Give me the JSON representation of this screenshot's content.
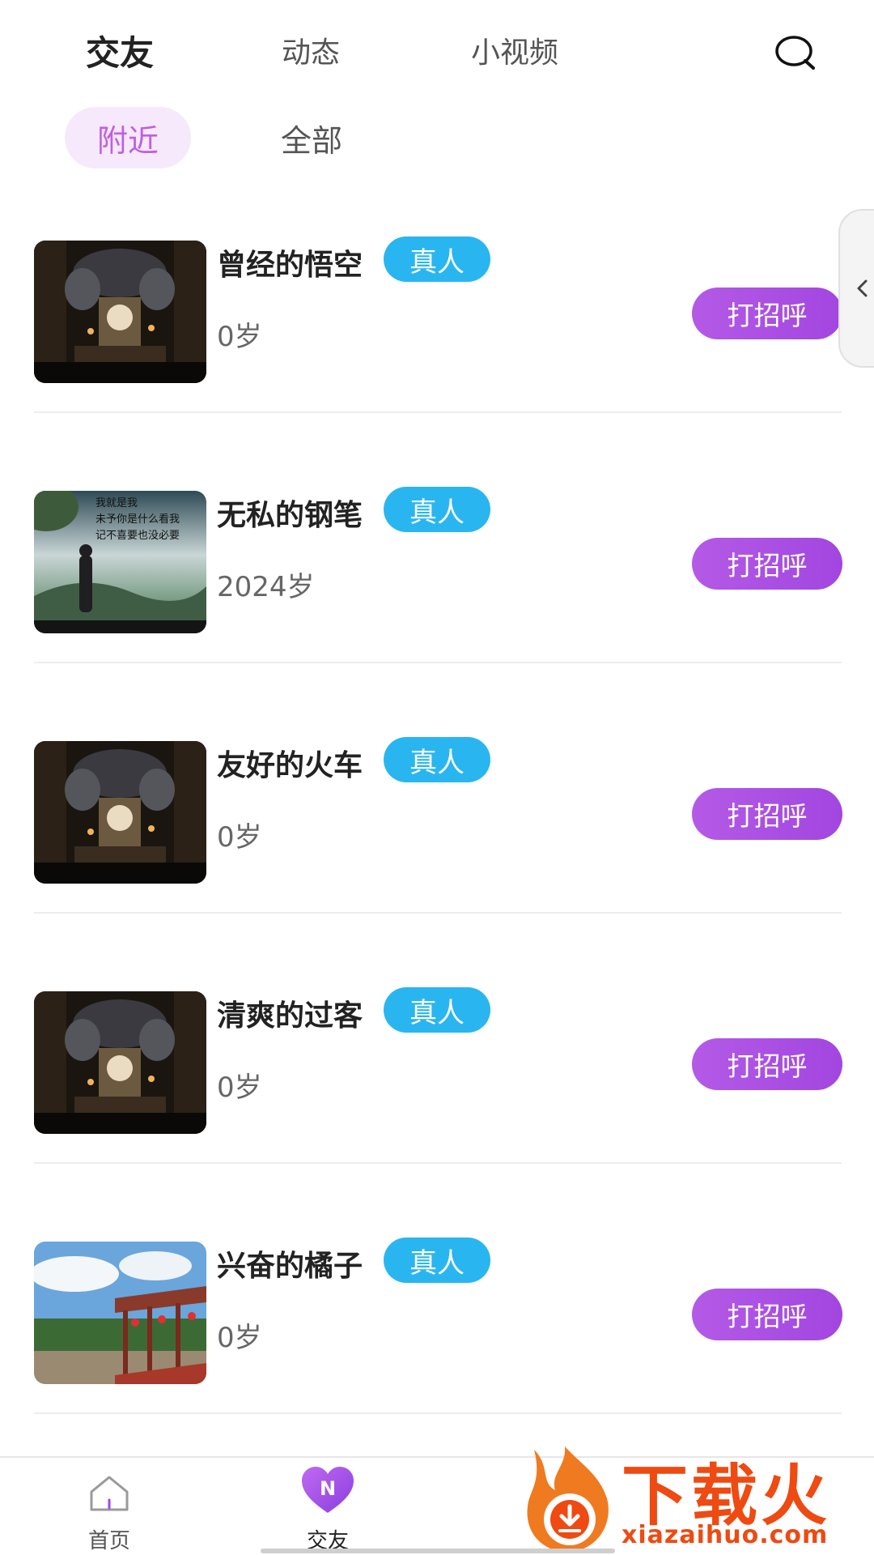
{
  "top_tabs": [
    {
      "label": "交友",
      "active": true
    },
    {
      "label": "动态",
      "active": false
    },
    {
      "label": "小视频",
      "active": false
    }
  ],
  "sub_tabs": [
    {
      "label": "附近",
      "active": true
    },
    {
      "label": "全部",
      "active": false
    }
  ],
  "users": [
    {
      "name": "曾经的悟空",
      "badge": "真人",
      "age": "0岁",
      "greet": "打招呼",
      "photo": "dark-library"
    },
    {
      "name": "无私的钢笔",
      "badge": "真人",
      "age": "2024岁",
      "greet": "打招呼",
      "photo": "man-misty-mountain"
    },
    {
      "name": "友好的火车",
      "badge": "真人",
      "age": "0岁",
      "greet": "打招呼",
      "photo": "dark-library"
    },
    {
      "name": "清爽的过客",
      "badge": "真人",
      "age": "0岁",
      "greet": "打招呼",
      "photo": "dark-library"
    },
    {
      "name": "兴奋的橘子",
      "badge": "真人",
      "age": "0岁",
      "greet": "打招呼",
      "photo": "garden-pavilion"
    }
  ],
  "bottom_nav": [
    {
      "label": "首页",
      "icon": "home-icon",
      "active": false
    },
    {
      "label": "交友",
      "icon": "heart-n-icon",
      "active": true
    }
  ],
  "photo_caption": [
    "我就是我",
    "未予你是什么看我",
    "记不喜要也没必要"
  ],
  "watermark": {
    "text": "下载火",
    "url": "xiazaihuo.com"
  },
  "colors": {
    "accent_purple": "#a246e0",
    "badge_blue": "#29b6f0",
    "active_subtab_bg": "#f6e9fb",
    "active_subtab_text": "#c15fe0",
    "watermark_orange": "#ee4a12"
  }
}
